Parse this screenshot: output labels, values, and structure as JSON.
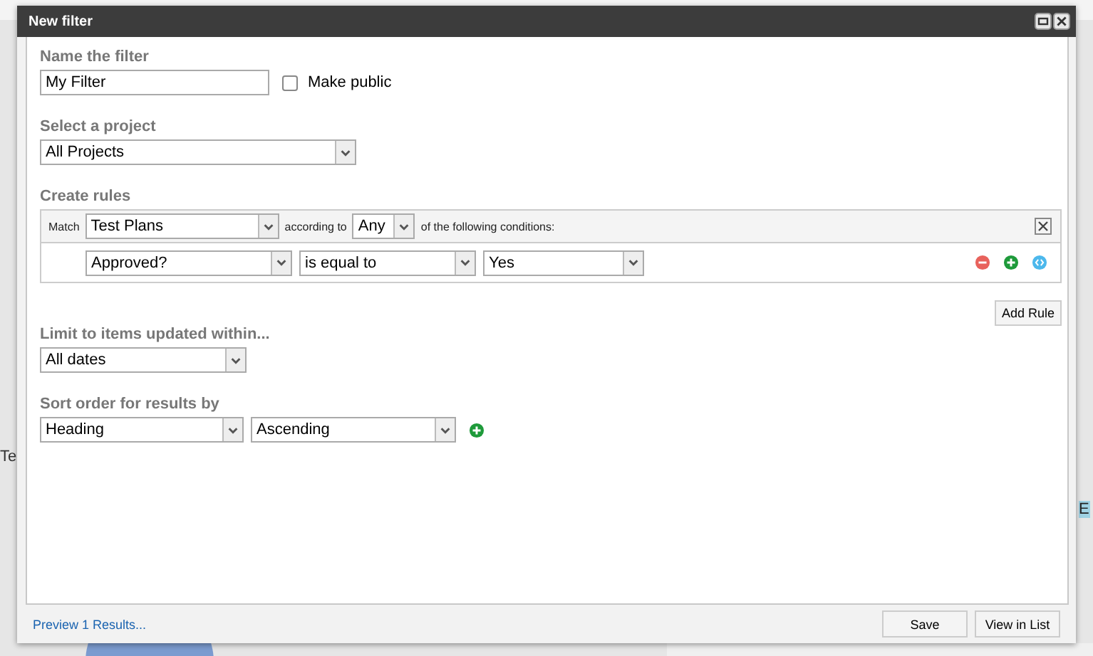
{
  "backdrop": {
    "texts": [
      {
        "kind": "left-fragment",
        "text": "Te"
      },
      {
        "kind": "right-fragment",
        "text": "E"
      }
    ]
  },
  "window": {
    "title": "New filter"
  },
  "name_section": {
    "label": "Name the filter",
    "value": "My Filter",
    "make_public": {
      "label": "Make public",
      "checked": false
    }
  },
  "project_section": {
    "label": "Select a project",
    "value": "All Projects"
  },
  "rules_section": {
    "label": "Create rules",
    "match_label": "Match",
    "match_value": "Test Plans",
    "according_label": "according to",
    "according_value": "Any",
    "conditions_label": "of the following conditions:",
    "rules": [
      {
        "field": "Approved?",
        "operator": "is equal to",
        "value": "Yes"
      }
    ],
    "add_rule": "Add Rule"
  },
  "limit_section": {
    "label": "Limit to items updated within...",
    "value": "All dates"
  },
  "sort_section": {
    "label": "Sort order for results by",
    "field": "Heading",
    "order": "Ascending"
  },
  "footer": {
    "preview_link": "Preview 1 Results...",
    "buttons": [
      "Save",
      "View in List"
    ]
  }
}
